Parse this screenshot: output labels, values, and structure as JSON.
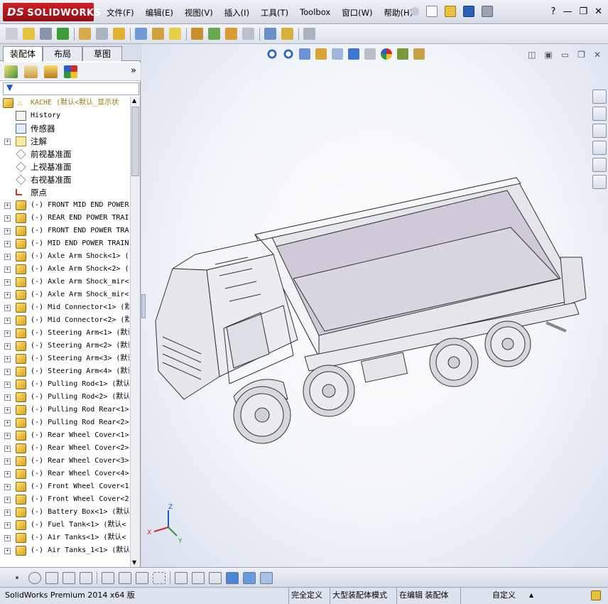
{
  "app": {
    "brand_prefix": "DS",
    "brand": "SOLIDWORKS"
  },
  "menu": [
    "文件(F)",
    "编辑(E)",
    "视图(V)",
    "插入(I)",
    "工具(T)",
    "Toolbox",
    "窗口(W)",
    "帮助(H)"
  ],
  "window_controls": {
    "help": "?",
    "minimize": "—",
    "restore": "❐",
    "close": "✕"
  },
  "panel_tabs": [
    "装配体",
    "布局",
    "草图"
  ],
  "panel_expand": "»",
  "tree": {
    "root": "KACHE  (默认<默认_显示状",
    "items": [
      {
        "label": "History",
        "cn": false,
        "expand": ""
      },
      {
        "label": "传感器",
        "cn": true,
        "expand": ""
      },
      {
        "label": "注解",
        "cn": true,
        "expand": "+"
      },
      {
        "label": "前视基准面",
        "cn": true,
        "expand": ""
      },
      {
        "label": "上视基准面",
        "cn": true,
        "expand": ""
      },
      {
        "label": "右视基准面",
        "cn": true,
        "expand": ""
      },
      {
        "label": "原点",
        "cn": true,
        "expand": ""
      },
      {
        "label": "(-) FRONT MID END POWER",
        "cn": false,
        "expand": "+"
      },
      {
        "label": "(-) REAR END POWER TRAI",
        "cn": false,
        "expand": "+"
      },
      {
        "label": "(-) FRONT END POWER TRA",
        "cn": false,
        "expand": "+"
      },
      {
        "label": "(-) MID END POWER TRAIN",
        "cn": false,
        "expand": "+"
      },
      {
        "label": "(-) Axle Arm Shock<1> (",
        "cn": false,
        "expand": "+"
      },
      {
        "label": "(-) Axle Arm Shock<2> (",
        "cn": false,
        "expand": "+"
      },
      {
        "label": "(-) Axle Arm Shock_mir<",
        "cn": false,
        "expand": "+"
      },
      {
        "label": "(-) Axle Arm Shock_mir<",
        "cn": false,
        "expand": "+"
      },
      {
        "label": "(-) Mid Connector<1> (默",
        "cn": false,
        "expand": "+"
      },
      {
        "label": "(-) Mid Connector<2> (默",
        "cn": false,
        "expand": "+"
      },
      {
        "label": "(-) Steering Arm<1> (默认",
        "cn": false,
        "expand": "+"
      },
      {
        "label": "(-) Steering Arm<2> (默认",
        "cn": false,
        "expand": "+"
      },
      {
        "label": "(-) Steering Arm<3> (默认",
        "cn": false,
        "expand": "+"
      },
      {
        "label": "(-) Steering Arm<4> (默认",
        "cn": false,
        "expand": "+"
      },
      {
        "label": "(-) Pulling Rod<1> (默认",
        "cn": false,
        "expand": "+"
      },
      {
        "label": "(-) Pulling Rod<2> (默认",
        "cn": false,
        "expand": "+"
      },
      {
        "label": "(-) Pulling Rod Rear<1>",
        "cn": false,
        "expand": "+"
      },
      {
        "label": "(-) Pulling Rod Rear<2>",
        "cn": false,
        "expand": "+"
      },
      {
        "label": "(-) Rear Wheel Cover<1>",
        "cn": false,
        "expand": "+"
      },
      {
        "label": "(-) Rear Wheel Cover<2>",
        "cn": false,
        "expand": "+"
      },
      {
        "label": "(-) Rear Wheel Cover<3>",
        "cn": false,
        "expand": "+"
      },
      {
        "label": "(-) Rear Wheel Cover<4>",
        "cn": false,
        "expand": "+"
      },
      {
        "label": "(-) Front Wheel Cover<1",
        "cn": false,
        "expand": "+"
      },
      {
        "label": "(-) Front Wheel Cover<2",
        "cn": false,
        "expand": "+"
      },
      {
        "label": "(-) Battery Box<1> (默认",
        "cn": false,
        "expand": "+"
      },
      {
        "label": "(-) Fuel Tank<1> (默认<",
        "cn": false,
        "expand": "+"
      },
      {
        "label": "(-) Air Tanks<1> (默认<",
        "cn": false,
        "expand": "+"
      },
      {
        "label": "(-) Air Tanks_1<1> (默认",
        "cn": false,
        "expand": "+"
      }
    ]
  },
  "triad": {
    "x": "X",
    "y": "Y",
    "z": "Z"
  },
  "status": {
    "product": "SolidWorks Premium 2014 x64 版",
    "definition": "完全定义",
    "mode": "大型装配体模式",
    "editing": "在编辑 装配体",
    "units": "自定义",
    "units_arrow": "▲"
  },
  "colors": {
    "brand_red": "#c8161d",
    "accent_blue": "#1f57c3"
  }
}
